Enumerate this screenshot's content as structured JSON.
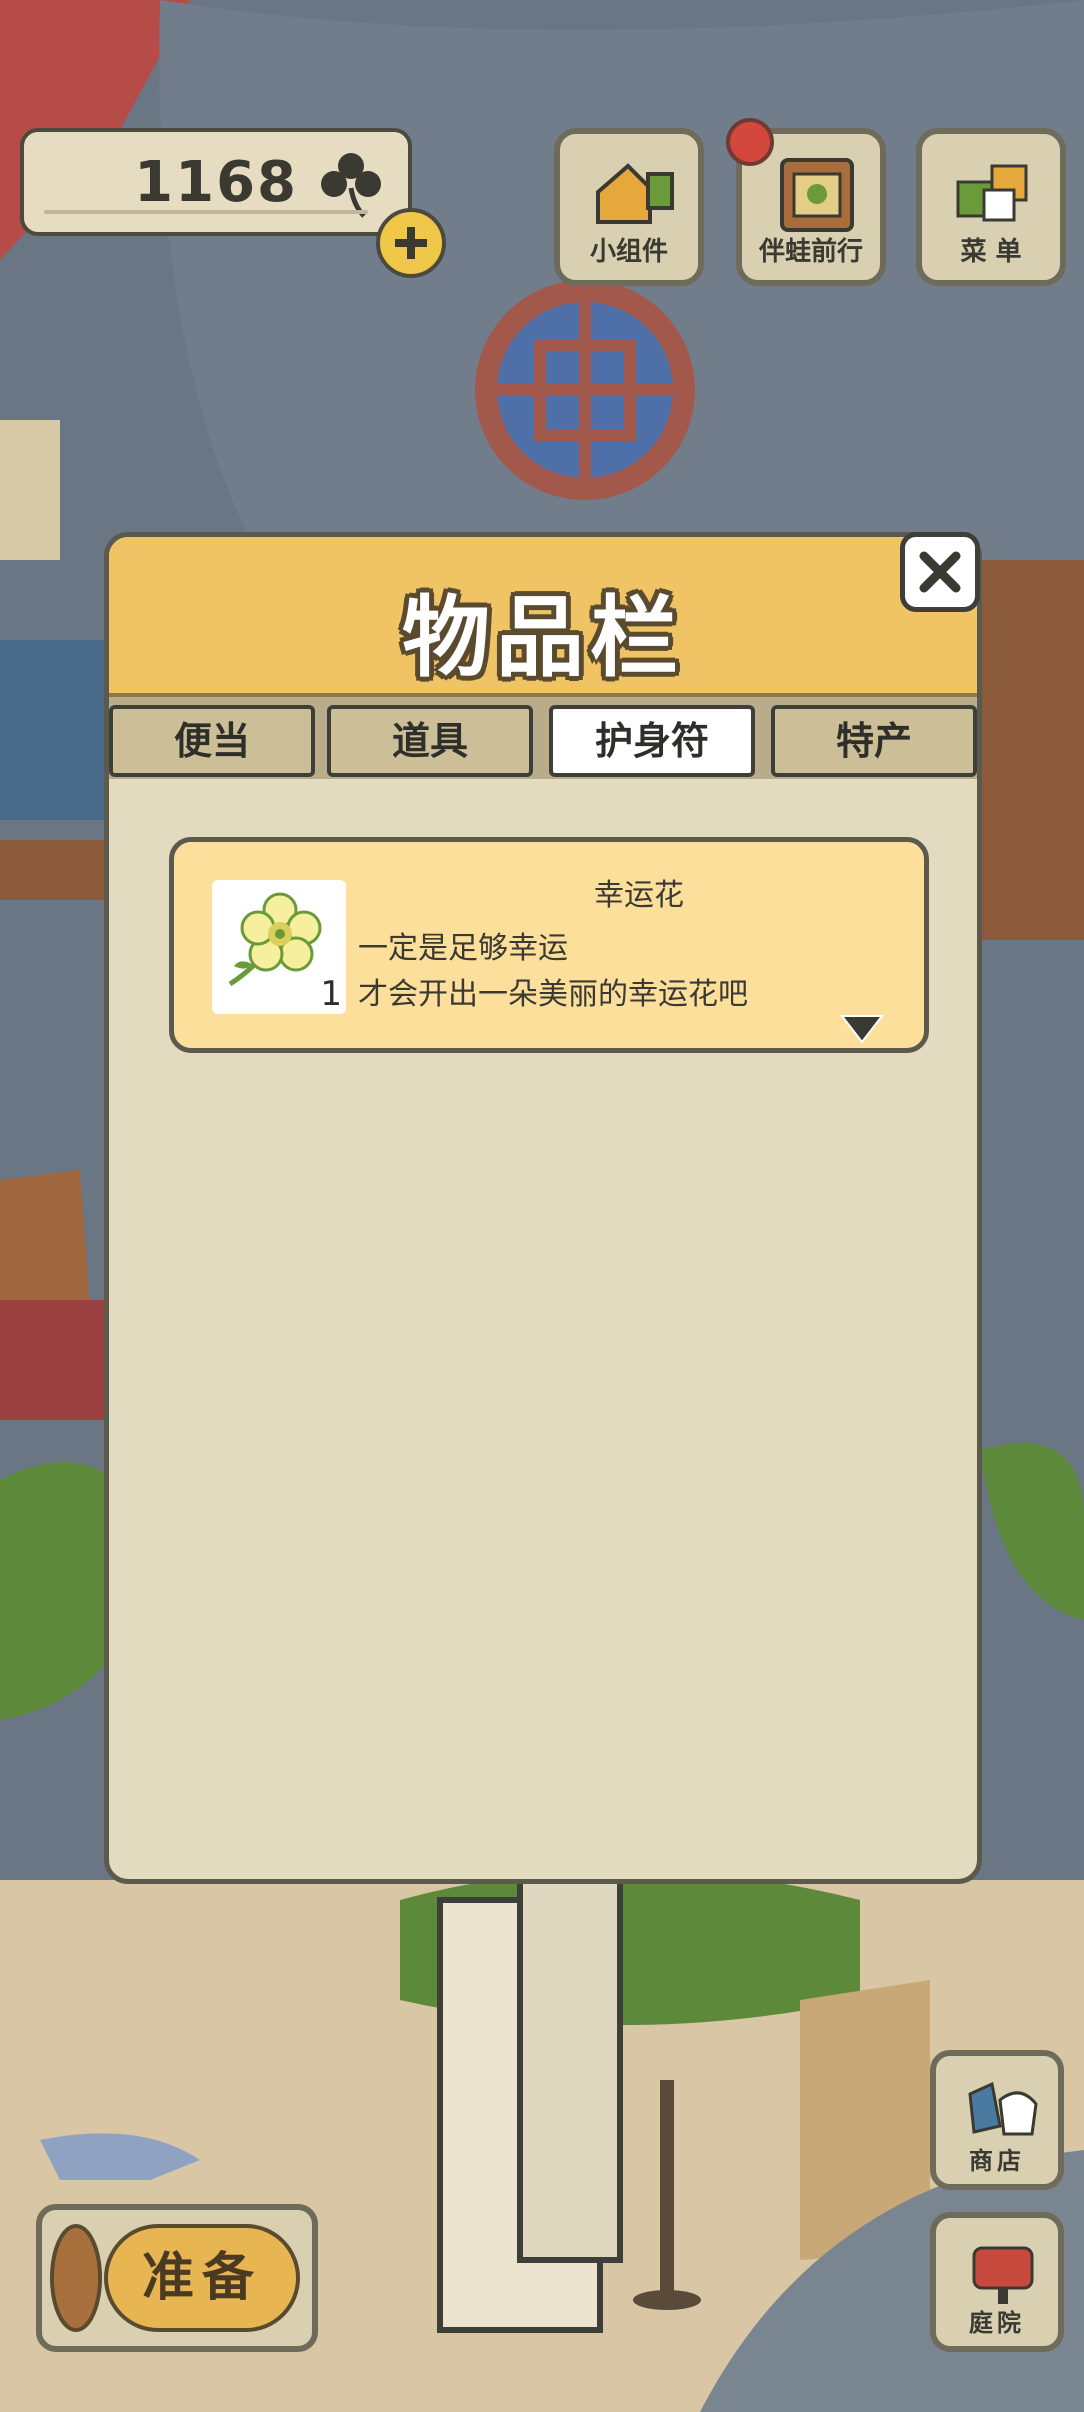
{
  "hud": {
    "clover_count": "1168",
    "buttons": {
      "widgets": "小组件",
      "travel_with_frog": "伴蛙前行",
      "menu": "菜 单"
    }
  },
  "inventory": {
    "title": "物品栏",
    "tabs": [
      {
        "label": "便当",
        "active": false
      },
      {
        "label": "道具",
        "active": false
      },
      {
        "label": "护身符",
        "active": true
      },
      {
        "label": "特产",
        "active": false
      }
    ],
    "items": [
      {
        "name": "幸运花",
        "quantity": "1",
        "description_line1": "一定是足够幸运",
        "description_line2": "才会开出一朵美丽的幸运花吧"
      }
    ]
  },
  "bottom": {
    "ready": "准备",
    "shop": "商店",
    "yard": "庭院"
  },
  "colors": {
    "header": "#f0c464",
    "panel": "#e2dbbf",
    "card": "#fddf9c",
    "accent_red": "#d3473c"
  }
}
